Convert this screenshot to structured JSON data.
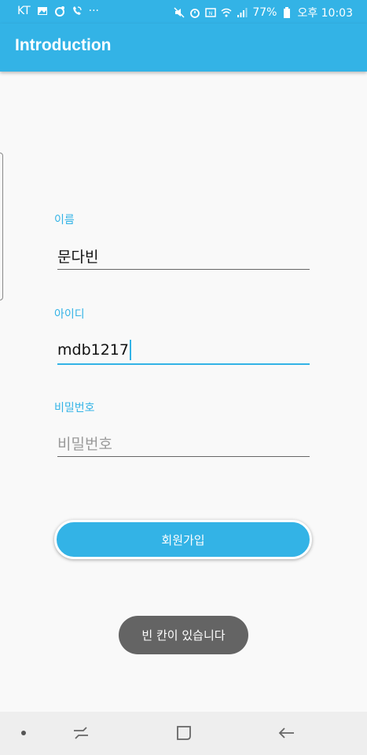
{
  "status_bar": {
    "carrier": "KT",
    "more": "···",
    "battery_percent": "77%",
    "time": "오후 10:03",
    "left_icons": [
      "image-icon",
      "sync-icon",
      "wifi-calling-icon"
    ],
    "right_icons": [
      "mute-icon",
      "alarm-icon",
      "nfc-icon",
      "wifi-icon",
      "signal-icon",
      "battery-icon"
    ]
  },
  "app_bar": {
    "title": "Introduction"
  },
  "form": {
    "name": {
      "label": "이름",
      "value": "문다빈"
    },
    "id": {
      "label": "아이디",
      "value": "mdb1217"
    },
    "password": {
      "label": "비밀번호",
      "placeholder": "비밀번호"
    }
  },
  "signup_button": {
    "label": "회원가입"
  },
  "toast": {
    "message": "빈 칸이 있습니다"
  },
  "nav_bar": {
    "icons": [
      "dot-icon",
      "recent-apps-icon",
      "home-icon",
      "back-icon"
    ]
  },
  "colors": {
    "accent": "#33b3e6",
    "background": "#f9f9f9",
    "toast": "#646464"
  }
}
